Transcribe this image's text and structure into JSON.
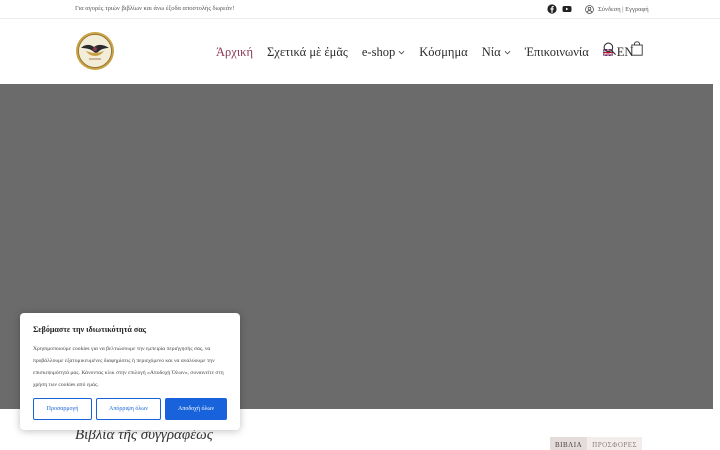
{
  "topbar": {
    "promo": "Για αγορές τριών βιβλίων και άνω έξοδα αποστολής δωρεάν!",
    "account_label": "Σύνδεση | Εγγραφή",
    "social_icons": [
      "facebook-icon",
      "youtube-icon"
    ]
  },
  "nav": {
    "items": [
      {
        "label": "Άρχική",
        "active": true
      },
      {
        "label": "Σχετικά μὲ ἐμᾶς"
      },
      {
        "label": "e-shop",
        "dropdown": true
      },
      {
        "label": "Κόσμημα"
      },
      {
        "label": "Νία",
        "dropdown": true
      },
      {
        "label": "Ἐπικοινωνία"
      },
      {
        "label": "EN",
        "flag": "uk-flag-icon"
      }
    ],
    "accent_color": "#8b3a52"
  },
  "hero": {
    "background": "#6b6b6b"
  },
  "section": {
    "title": "Βιβλία τῆς συγγραφέως",
    "tabs": [
      "ΒΙΒΛΙΑ",
      "ΠΡΟΣΦΟΡΕΣ"
    ]
  },
  "cookie": {
    "title": "Σεβόμαστε την ιδιωτικότητά σας",
    "text": "Χρησιμοποιούμε cookies για να βελτιώσουμε την εμπειρία περιήγησής σας, να προβάλλουμε εξατομικευμένες διαφημίσεις ή περιεχόμενο και να αναλύουμε την επισκεψιμότητά μας. Κάνοντας κλικ στην επιλογή «Αποδοχή Όλων», συναινείτε στη χρήση των cookies από εμάς.",
    "btn_customize": "Προσαρμογή",
    "btn_reject": "Απόρριψη όλων",
    "btn_accept": "Αποδοχή όλων",
    "accent_color": "#1863dc"
  }
}
